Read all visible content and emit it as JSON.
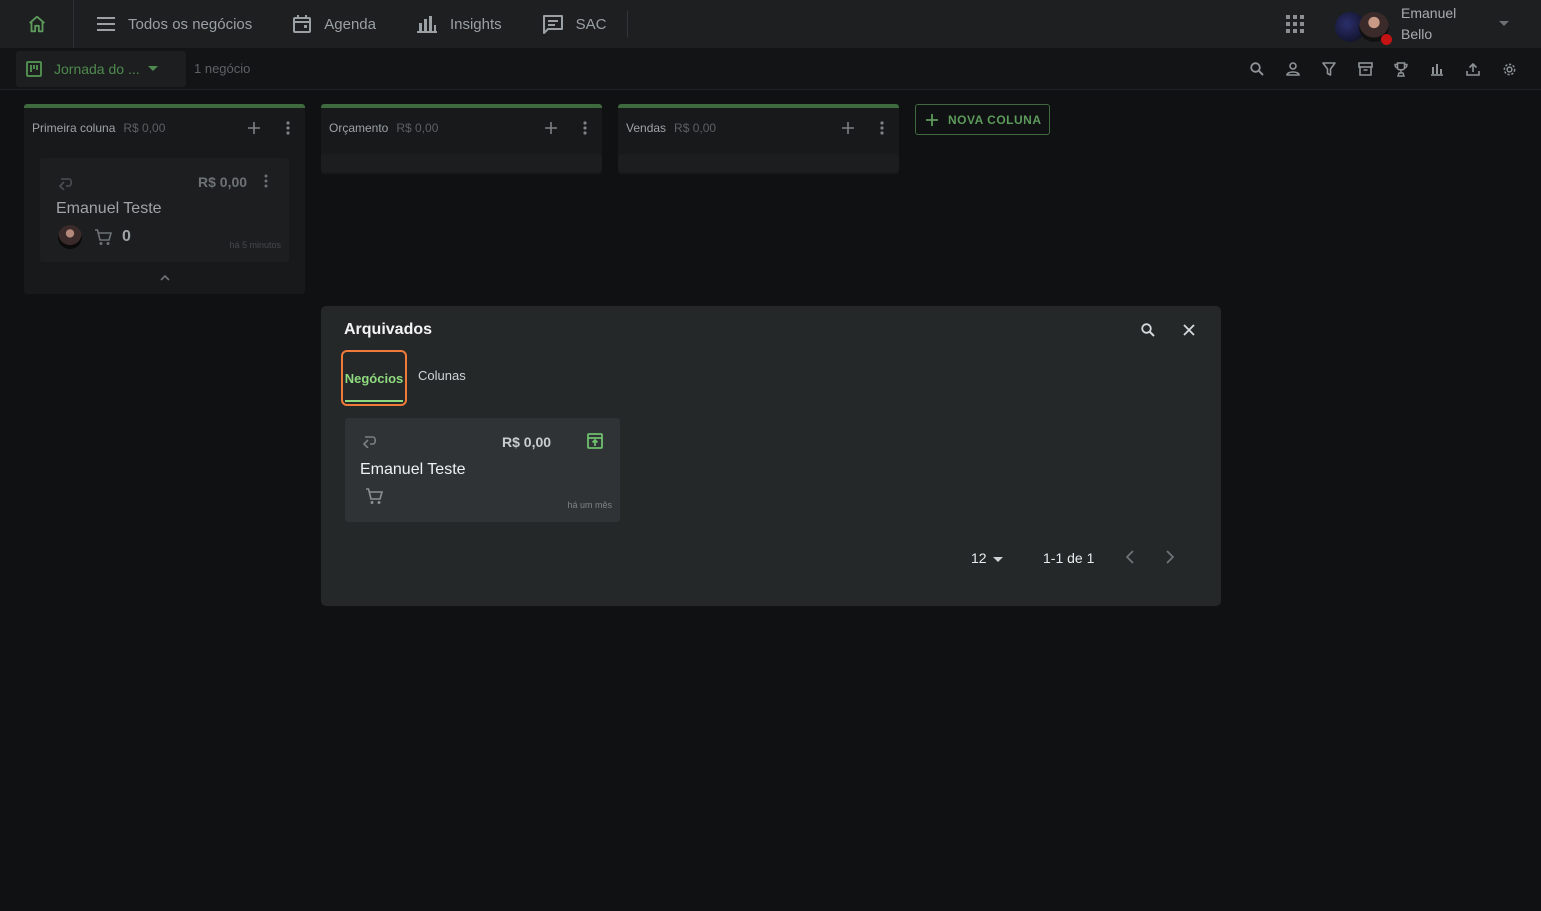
{
  "colors": {
    "accent": "#5d9a5c",
    "tab_active": "#8fda7f",
    "focus_ring": "#f07a3a",
    "status_dot": "#c51313"
  },
  "nav": {
    "items": [
      {
        "label": "Todos os negócios",
        "icon": "list-icon"
      },
      {
        "label": "Agenda",
        "icon": "calendar-icon"
      },
      {
        "label": "Insights",
        "icon": "bar-chart-icon"
      },
      {
        "label": "SAC",
        "icon": "chat-icon"
      }
    ],
    "user": {
      "first_name": "Emanuel",
      "last_name": "Bello"
    }
  },
  "toolbar": {
    "pipeline": "Jornada do ...",
    "deal_count": "1 negócio"
  },
  "columns": [
    {
      "title": "Primeira coluna",
      "value": "R$ 0,00"
    },
    {
      "title": "Orçamento",
      "value": "R$ 0,00"
    },
    {
      "title": "Vendas",
      "value": "R$ 0,00"
    }
  ],
  "board_card": {
    "value": "R$ 0,00",
    "title": "Emanuel Teste",
    "count": "0",
    "time": "há 5 minutos"
  },
  "new_column_label": "NOVA COLUNA",
  "modal": {
    "title": "Arquivados",
    "tabs": [
      "Negócios",
      "Colunas"
    ],
    "card": {
      "value": "R$ 0,00",
      "title": "Emanuel Teste",
      "time": "há um mês"
    },
    "pagination": {
      "page_size": "12",
      "range": "1-1 de 1"
    }
  }
}
